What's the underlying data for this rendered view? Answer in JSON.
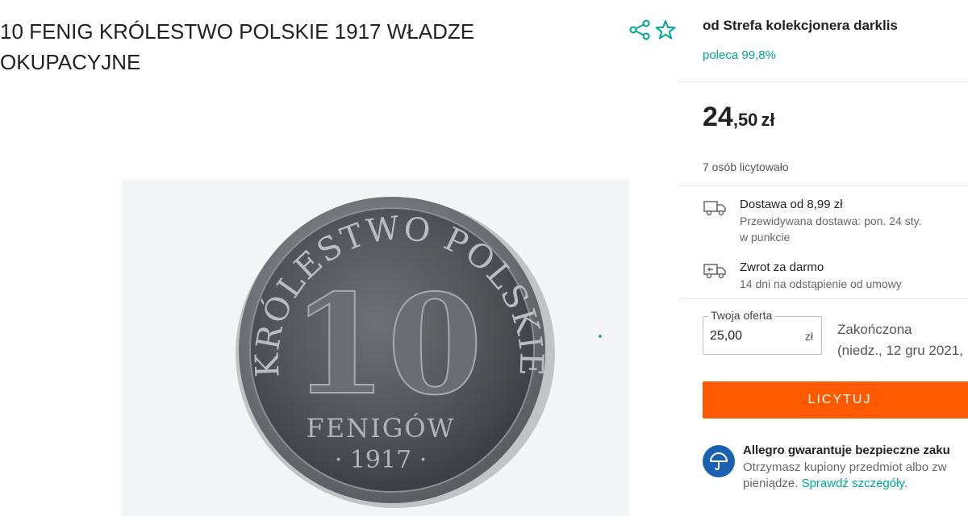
{
  "listing": {
    "title": "10 FENIG KRÓLESTWO POLSKIE 1917 WŁADZE OKUPACYJNE",
    "image": {
      "coin_top_text": "KRÓLESTWO POLSKIE",
      "coin_value": "10",
      "coin_unit": "FENIGÓW",
      "coin_year": "· 1917 ·"
    }
  },
  "seller": {
    "name": "od Strefa kolekcjonera darklis",
    "recommend": "poleca 99,8%"
  },
  "price": {
    "integer": "24",
    "fraction": ",50",
    "currency": "zł"
  },
  "bidders": "7 osób licytowało",
  "delivery": {
    "title": "Dostawa od 8,99 zł",
    "sub1": "Przewidywana dostawa: pon. 24 sty.",
    "sub2": "w punkcie"
  },
  "returns": {
    "title": "Zwrot za darmo",
    "sub": "14 dni na odstąpienie od umowy"
  },
  "offer": {
    "legend": "Twoja oferta",
    "value": "25,00",
    "unit": "zł"
  },
  "status": {
    "line1": "Zakończona",
    "line2": "(niedz., 12 gru 2021,"
  },
  "bid_button": "LICYTUJ",
  "guarantee": {
    "title": "Allegro gwarantuje bezpieczne zaku",
    "sub1": "Otrzymasz kupiony przedmiot albo zw",
    "sub2_text": "pieniądze. ",
    "link": "Sprawdź szczegóły",
    "sub2_end": "."
  },
  "colors": {
    "accent": "#00a790",
    "button": "#ff5a00",
    "guarantee_icon": "#1a62b0"
  },
  "icons": [
    "share-icon",
    "star-icon",
    "truck-icon",
    "return-truck-icon",
    "umbrella-icon"
  ]
}
